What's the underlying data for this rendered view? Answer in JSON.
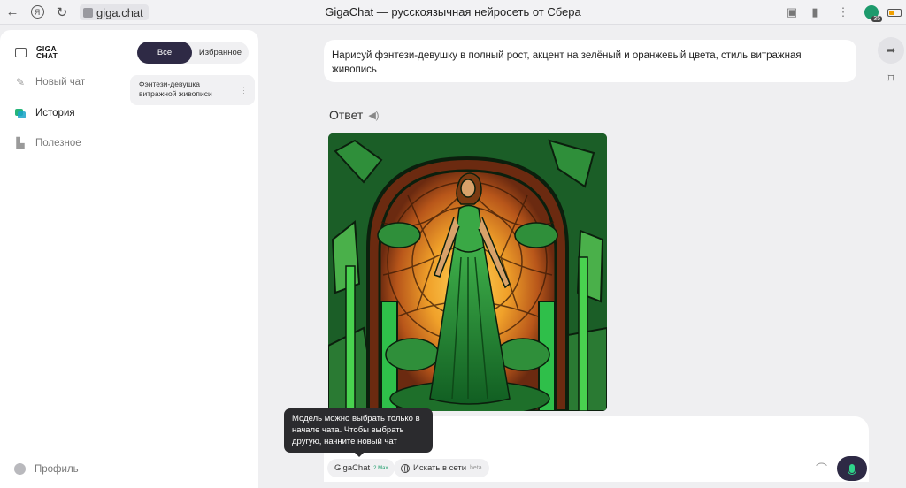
{
  "browser": {
    "address": "giga.chat",
    "title": "GigaChat — русскоязычная нейросеть от Сбера",
    "extension_badge": "35"
  },
  "sidebar": {
    "logo_line1": "GIGA",
    "logo_line2": "CHAT",
    "items": [
      {
        "label": "Новый чат",
        "icon": "pencil-icon"
      },
      {
        "label": "История",
        "icon": "history-icon"
      },
      {
        "label": "Полезное",
        "icon": "useful-icon"
      }
    ],
    "profile_label": "Профиль"
  },
  "history": {
    "tabs": [
      "Все",
      "Избранное"
    ],
    "active_tab": "Все",
    "items": [
      {
        "title_line1": "Фэнтези-девушка",
        "title_line2": "витражной живописи"
      }
    ]
  },
  "chat": {
    "user_message": "Нарисуй фэнтези-девушку в полный рост, акцент на зелёный и оранжевый цвета, стиль витражная живопись",
    "answer_label": "Ответ"
  },
  "composer": {
    "model_chip": "GigaChat",
    "model_badge": "2 Max",
    "search_chip": "Искать в сети",
    "search_badge": "beta",
    "tooltip": "Модель можно выбрать только в начале чата. Чтобы выбрать другую, начните новый чат"
  },
  "colors": {
    "accent_dark": "#2e2a45",
    "accent_green": "#2fd48b",
    "art_green": "#1e7a2e",
    "art_orange": "#e08a1a"
  }
}
